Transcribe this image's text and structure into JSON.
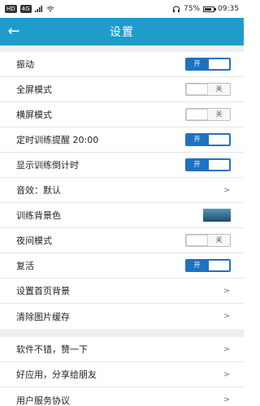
{
  "status": {
    "left_chips": [
      "HD",
      "4G"
    ],
    "battery": "75%",
    "time": "09:35"
  },
  "topbar": {
    "back_label": "←",
    "title": "设置"
  },
  "toggles": {
    "on_text": "开",
    "off_text": "关"
  },
  "settings": [
    {
      "label": "振动",
      "control": "toggle",
      "value": true
    },
    {
      "label": "全屏模式",
      "control": "toggle",
      "value": false
    },
    {
      "label": "横屏模式",
      "control": "toggle",
      "value": false
    },
    {
      "label": "定时训练提醒  20:00",
      "control": "toggle",
      "value": true
    },
    {
      "label": "显示训练倒计时",
      "control": "toggle",
      "value": true
    },
    {
      "label": "音效：默认",
      "control": "chevron"
    },
    {
      "label": "训练背景色",
      "control": "swatch",
      "swatch_colors": [
        "#5a96b7",
        "#1c4d6b"
      ]
    },
    {
      "label": "夜间模式",
      "control": "toggle",
      "value": false
    },
    {
      "label": "复活",
      "control": "toggle",
      "value": true
    },
    {
      "label": "设置首页背景",
      "control": "chevron"
    },
    {
      "label": "清除图片缓存",
      "control": "chevron"
    }
  ],
  "settings2": [
    {
      "label": "软件不错，赞一下",
      "control": "chevron"
    },
    {
      "label": "好应用，分享给朋友",
      "control": "chevron"
    },
    {
      "label": "用户服务协议",
      "control": "chevron"
    }
  ],
  "colors": {
    "topbar": "#1f9ccc",
    "toggle_on": "#1e72c2",
    "background": "#eeeeee"
  }
}
